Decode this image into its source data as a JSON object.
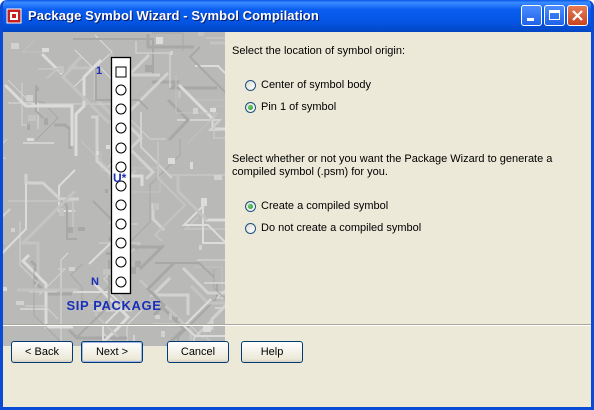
{
  "window": {
    "title": "Package Symbol Wizard - Symbol Compilation"
  },
  "preview": {
    "pin_first_label": "1",
    "pin_last_label": "N",
    "ref_label": "U*",
    "package_label": "SIP PACKAGE"
  },
  "origin": {
    "question": "Select the location of symbol origin:",
    "options": [
      "Center of symbol body",
      "Pin 1 of symbol"
    ],
    "selected": "Pin 1 of symbol"
  },
  "compile": {
    "question_line1": "Select whether or not you want the Package Wizard to generate a",
    "question_line2": "compiled symbol (.psm) for you.",
    "options": [
      "Create a compiled symbol",
      "Do not create a compiled symbol"
    ],
    "selected": "Create a compiled symbol"
  },
  "buttons": {
    "back": "< Back",
    "next": "Next >",
    "cancel": "Cancel",
    "help": "Help"
  },
  "colors": {
    "title_bar": "#0a5ef0",
    "dialog_bg": "#ece9d8",
    "package_label": "#1a2fb8"
  }
}
